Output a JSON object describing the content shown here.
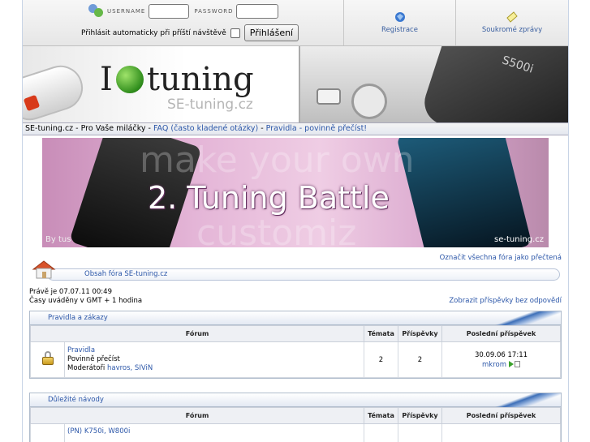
{
  "login": {
    "username_label": "USERNAME",
    "password_label": "PASSWORD",
    "autologin_label": "Přihlásit automaticky při příští návštěvě",
    "login_button": "Přihlášení"
  },
  "top_links": {
    "register": "Registrace",
    "messages": "Soukromé zprávy"
  },
  "banner": {
    "logo_left": "I",
    "logo_right": "tuning",
    "subtitle": "SE-tuning.cz",
    "phone_model": "S500i"
  },
  "nav": {
    "site": "SE-tuning.cz",
    "separator": " - ",
    "slogan": "Pro Vaše miláčky",
    "faq": "FAQ (často kladené otázky)",
    "rules": "Pravidla - povinně přečíst!"
  },
  "battle_banner": {
    "title": "2. Tuning Battle",
    "ghost_top": "make your own",
    "ghost_bottom": "customiz",
    "by": "By tus",
    "watermark": "se-tuning.cz"
  },
  "forum_index": {
    "mark_all_read": "Označit všechna fóra jako přečtená",
    "breadcrumb": "Obsah fóra SE-tuning.cz",
    "current_time": "Právě je 07.07.11 00:49",
    "timezone": "Časy uváděny v GMT + 1 hodina",
    "unanswered": "Zobrazit příspěvky bez odpovědí",
    "columns": {
      "forum": "Fórum",
      "topics": "Témata",
      "posts": "Příspěvky",
      "last_post": "Poslední příspěvek"
    },
    "categories": [
      {
        "title": "Pravidla a zákazy",
        "forums": [
          {
            "name": "Pravidla",
            "description": "Povinně přečíst",
            "moderators_label": "Moderátoři",
            "moderators": "havros, SIViN",
            "topics": "2",
            "posts": "2",
            "last_post_date": "30.09.06 17:11",
            "last_post_user": "mkrom"
          }
        ]
      },
      {
        "title": "Důležité návody",
        "forums": [
          {
            "name": "(PN) K750i, W800i"
          }
        ]
      }
    ]
  }
}
